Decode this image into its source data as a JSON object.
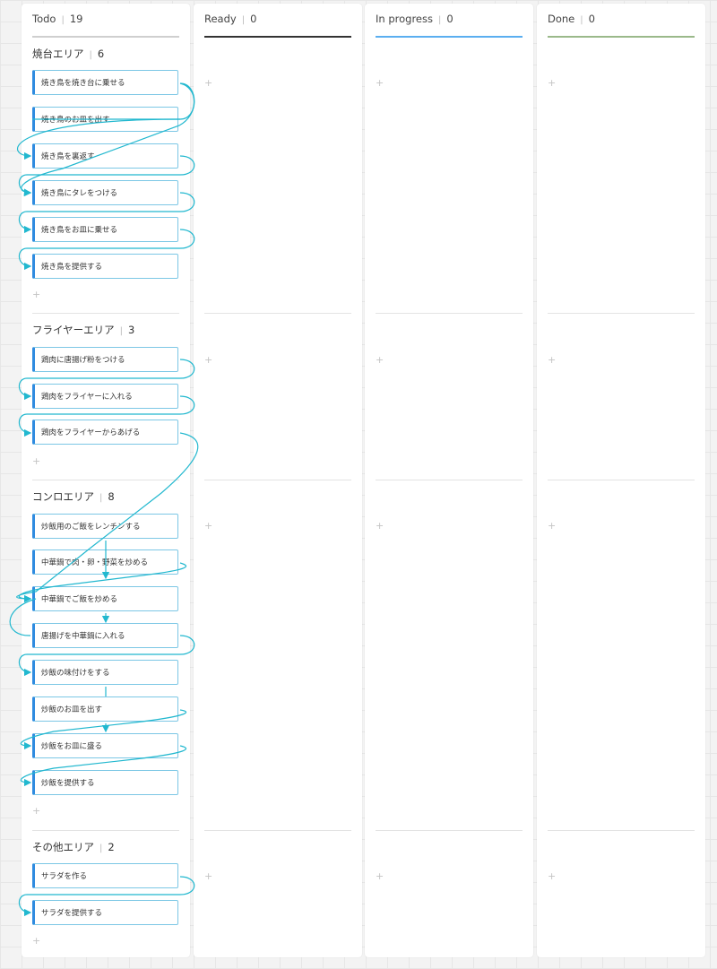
{
  "columns": [
    {
      "title": "Todo",
      "count": "19",
      "underline": "#cfcfcf"
    },
    {
      "title": "Ready",
      "count": "0",
      "underline": "#333333"
    },
    {
      "title": "In progress",
      "count": "0",
      "underline": "#5aaef0"
    },
    {
      "title": "Done",
      "count": "0",
      "underline": "#9ab98a"
    }
  ],
  "groups": [
    {
      "title": "焼台エリア",
      "count": "6",
      "cards": [
        "焼き鳥を焼き台に乗せる",
        "焼き鳥のお皿を出す",
        "焼き鳥を裏返す",
        "焼き鳥にタレをつける",
        "焼き鳥をお皿に乗せる",
        "焼き鳥を提供する"
      ]
    },
    {
      "title": "フライヤーエリア",
      "count": "3",
      "cards": [
        "鶏肉に唐揚げ粉をつける",
        "鶏肉をフライヤーに入れる",
        "鶏肉をフライヤーからあげる"
      ]
    },
    {
      "title": "コンロエリア",
      "count": "8",
      "cards": [
        "炒飯用のご飯をレンチンする",
        "中華鍋で肉・卵・野菜を炒める",
        "中華鍋でご飯を炒める",
        "唐揚げを中華鍋に入れる",
        "炒飯の味付けをする",
        "炒飯のお皿を出す",
        "炒飯をお皿に盛る",
        "炒飯を提供する"
      ]
    },
    {
      "title": "その他エリア",
      "count": "2",
      "cards": [
        "サラダを作る",
        "サラダを提供する"
      ]
    }
  ],
  "add_symbol": "+",
  "accent_color": "#2f8be0",
  "connector_color": "#22b8cf"
}
